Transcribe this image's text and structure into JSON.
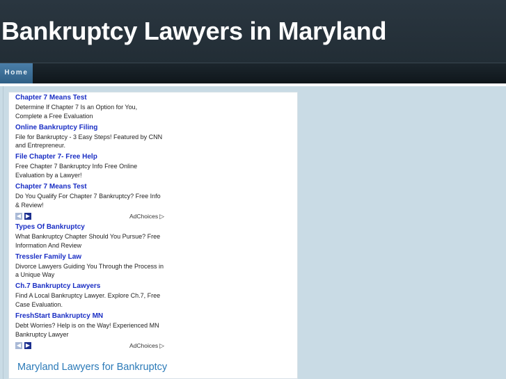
{
  "site": {
    "title": "Bankruptcy Lawyers in Maryland"
  },
  "nav": {
    "items": [
      {
        "label": "Home"
      }
    ]
  },
  "ads": {
    "block1": [
      {
        "title": "Chapter 7 Means Test",
        "desc": "Determine If Chapter 7 Is an Option for You, Complete a Free Evaluation"
      },
      {
        "title": "Online Bankruptcy Filing",
        "desc": "File for Bankruptcy - 3 Easy Steps! Featured by CNN and Entrepreneur."
      },
      {
        "title": "File Chapter 7- Free Help",
        "desc": "Free Chapter 7 Bankruptcy Info Free Online Evaluation by a Lawyer!"
      },
      {
        "title": "Chapter 7 Means Test",
        "desc": "Do You Qualify For Chapter 7 Bankruptcy? Free Info & Review!"
      }
    ],
    "block2": [
      {
        "title": "Types Of Bankruptcy",
        "desc": "What Bankruptcy Chapter Should You Pursue? Free Information And Review"
      },
      {
        "title": "Tressler Family Law",
        "desc": "Divorce Lawyers Guiding You Through the Process in a Unique Way"
      },
      {
        "title": "Ch.7 Bankruptcy Lawyers",
        "desc": "Find A Local Bankruptcy Lawyer. Explore Ch.7, Free Case Evaluation."
      },
      {
        "title": "FreshStart Bankruptcy MN",
        "desc": "Debt Worries? Help is on the Way! Experienced MN Bankruptcy Lawyer"
      }
    ],
    "adchoices_label": "AdChoices",
    "prev_glyph": "◀",
    "next_glyph": "▶",
    "adchoices_glyph": "▷"
  },
  "main": {
    "section_heading": "Maryland Lawyers for Bankruptcy"
  },
  "colors": {
    "header_bg": "#222d35",
    "nav_active": "#3a6d96",
    "page_bg": "#c9dbe5",
    "ad_title": "#1a2ec4",
    "heading": "#2b7ab8"
  }
}
